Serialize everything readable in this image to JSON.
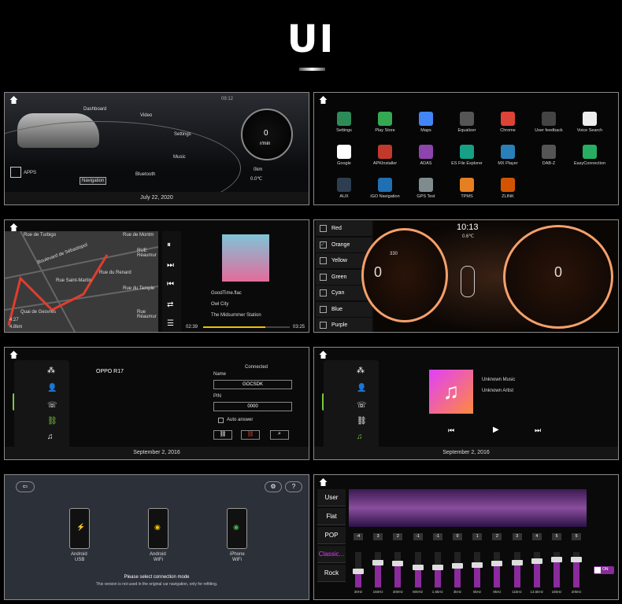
{
  "header": {
    "title": "UI"
  },
  "p1": {
    "date": "July 22, 2020",
    "top_time": "09:12",
    "dashboard": "Dashboard",
    "video": "Video",
    "settings": "Settings",
    "music": "Music",
    "apps": "APPS",
    "navigation": "Navigation",
    "bluetooth": "Bluetooth",
    "speed": "0",
    "speed_unit": "r/min",
    "distance": "0km",
    "temp": "0.0℃"
  },
  "p2": {
    "apps": [
      {
        "label": "Settings",
        "color": "#2e8b57"
      },
      {
        "label": "Play Store",
        "color": "#34a853"
      },
      {
        "label": "Maps",
        "color": "#4285f4"
      },
      {
        "label": "Equalizer",
        "color": "#555"
      },
      {
        "label": "Chrome",
        "color": "#db4437"
      },
      {
        "label": "User feedback",
        "color": "#444"
      },
      {
        "label": "Voice Search",
        "color": "#eee"
      },
      {
        "label": "Google",
        "color": "#fff"
      },
      {
        "label": "APKInstaller",
        "color": "#c0392b"
      },
      {
        "label": "ADAS",
        "color": "#8e44ad"
      },
      {
        "label": "ES File Explorer",
        "color": "#16a085"
      },
      {
        "label": "MX Player",
        "color": "#2980b9"
      },
      {
        "label": "DAB-Z",
        "color": "#555"
      },
      {
        "label": "EasyConnection",
        "color": "#27ae60"
      },
      {
        "label": "AUX",
        "color": "#2c3e50"
      },
      {
        "label": "iGO Navigation",
        "color": "#1f6fb2"
      },
      {
        "label": "GPS Test",
        "color": "#7f8c8d"
      },
      {
        "label": "TPMS",
        "color": "#e67e22"
      },
      {
        "label": "ZLINK",
        "color": "#d35400"
      }
    ]
  },
  "p3": {
    "streets": [
      "Rue de Turbigo",
      "Boulevard de Sébastopol",
      "Rue de Montm",
      "RUE Réaumur",
      "Rue Saint-Martin",
      "Rue du Renard",
      "Rue du Temple",
      "Quai de Gesvres",
      "Rue Réaumur"
    ],
    "song": "GoodTime.flac",
    "artist": "Owl City",
    "album": "The Midsummer Station",
    "elapsed": "02:39",
    "total": "03:25",
    "progress": 0.72,
    "nav_time": "4:27",
    "nav_dist": "4.8km"
  },
  "p4": {
    "colors": [
      "Red",
      "Orange",
      "Yellow",
      "Green",
      "Cyan",
      "Blue",
      "Purple"
    ],
    "selected": "Orange",
    "clock": "10:13",
    "temp": "0.6℃",
    "left_gauge": "0",
    "right_gauge": "0",
    "left_mark": "330"
  },
  "p5": {
    "date": "September 2, 2016",
    "device": "OPPO R17",
    "status": "Connected",
    "name_label": "Name",
    "name_value": "GOCSDK",
    "pin_label": "PIN",
    "pin_value": "0000",
    "auto_answer": "Auto answer"
  },
  "p6": {
    "date": "September 2, 2016",
    "music": "Unknown Music",
    "artist": "Unknown Artist"
  },
  "p7": {
    "phones": [
      {
        "label": "Android",
        "sub": "USB"
      },
      {
        "label": "Android",
        "sub": "WiFi"
      },
      {
        "label": "iPhone",
        "sub": "WiFi"
      }
    ],
    "prompt": "Please select connection mode",
    "note": "This version is not used in the original car navigation, only for refitting."
  },
  "p8": {
    "presets": [
      "User",
      "Flat",
      "POP",
      "Classic...",
      "Rock"
    ],
    "active": "Classic...",
    "toggle": "ON",
    "bands": [
      {
        "f": "30Hz",
        "v": "-4",
        "l": 0.45
      },
      {
        "f": "150Hz",
        "v": "3",
        "l": 0.7
      },
      {
        "f": "300Hz",
        "v": "2",
        "l": 0.66
      },
      {
        "f": "800Hz",
        "v": "-1",
        "l": 0.55
      },
      {
        "f": "1.5kHz",
        "v": "-1",
        "l": 0.55
      },
      {
        "f": "3kHz",
        "v": "0",
        "l": 0.6
      },
      {
        "f": "5kHz",
        "v": "1",
        "l": 0.62
      },
      {
        "f": "8kHz",
        "v": "2",
        "l": 0.66
      },
      {
        "f": "11kHz",
        "v": "3",
        "l": 0.7
      },
      {
        "f": "13.5kHz",
        "v": "4",
        "l": 0.73
      },
      {
        "f": "16kHz",
        "v": "5",
        "l": 0.78
      },
      {
        "f": "20kHz",
        "v": "5",
        "l": 0.78
      }
    ]
  }
}
